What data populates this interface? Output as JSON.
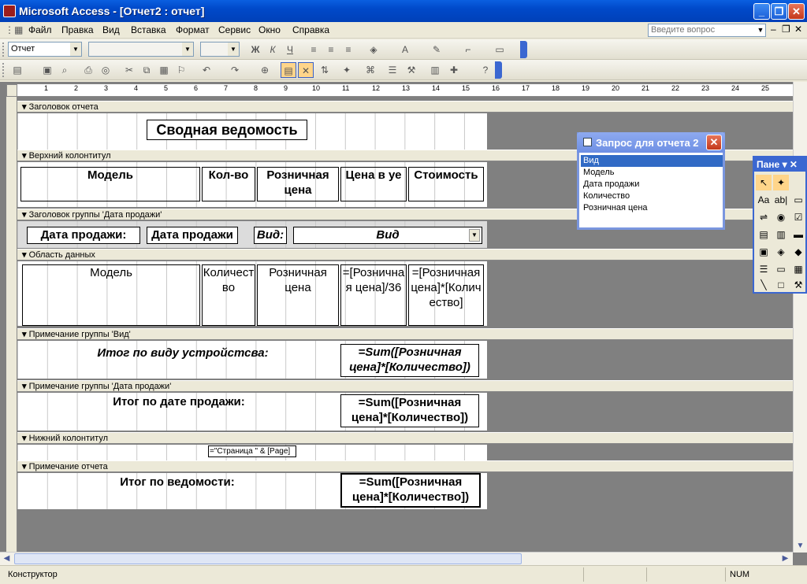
{
  "window": {
    "title": "Microsoft Access - [Отчет2 : отчет]",
    "min": "_",
    "restore": "❐",
    "close": "✕"
  },
  "menu": {
    "items": [
      "Файл",
      "Правка",
      "Вид",
      "Вставка",
      "Формат",
      "Сервис",
      "Окно",
      "Справка"
    ],
    "help_placeholder": "Введите вопрос"
  },
  "toolbar": {
    "object_combo": "Отчет",
    "font_combo": "",
    "size_combo": ""
  },
  "ruler": {
    "marks": [
      "1",
      "2",
      "3",
      "4",
      "5",
      "6",
      "7",
      "8",
      "9",
      "10",
      "11",
      "12",
      "13",
      "14",
      "15",
      "16",
      "17",
      "18",
      "19",
      "20",
      "21",
      "22",
      "23",
      "24",
      "25"
    ]
  },
  "sections": {
    "report_header": {
      "bar": "Заголовок отчета",
      "title": "Сводная ведомость"
    },
    "page_header": {
      "bar": "Верхний колонтитул",
      "col_model": "Модель",
      "col_qty": "Кол-во",
      "col_price": "Розничная цена",
      "col_price_ue": "Цена в уе",
      "col_cost": "Стоимость"
    },
    "group_header_date": {
      "bar": "Заголовок группы 'Дата продажи'",
      "label_date": "Дата продажи:",
      "field_date": "Дата продажи",
      "label_type": "Вид:",
      "field_type": "Вид"
    },
    "detail": {
      "bar": "Область данных",
      "model": "Модель",
      "qty": "Количество",
      "price": "Розничная цена",
      "price_ue": "=[Розничная цена]/36",
      "cost": "=[Розничная цена]*[Количество]"
    },
    "group_footer_type": {
      "bar": "Примечание группы 'Вид'",
      "label": "Итог по виду устройстсва:",
      "sum": "=Sum([Розничная цена]*[Количество])"
    },
    "group_footer_date": {
      "bar": "Примечание группы 'Дата продажи'",
      "label": "Итог по дате продажи:",
      "sum": "=Sum([Розничная цена]*[Количество])"
    },
    "page_footer": {
      "bar": "Нижний колонтитул",
      "page_expr": "=\"Страница \" & [Page]"
    },
    "report_footer": {
      "bar": "Примечание отчета",
      "label": "Итог по ведомости:",
      "sum": "=Sum([Розничная цена]*[Количество])"
    }
  },
  "field_list": {
    "title": "Запрос для отчета 2",
    "fields": [
      "Вид",
      "Модель",
      "Дата продажи",
      "Количество",
      "Розничная цена"
    ]
  },
  "toolbox": {
    "title": "Пане"
  },
  "status": {
    "mode": "Конструктор",
    "num": "NUM"
  }
}
